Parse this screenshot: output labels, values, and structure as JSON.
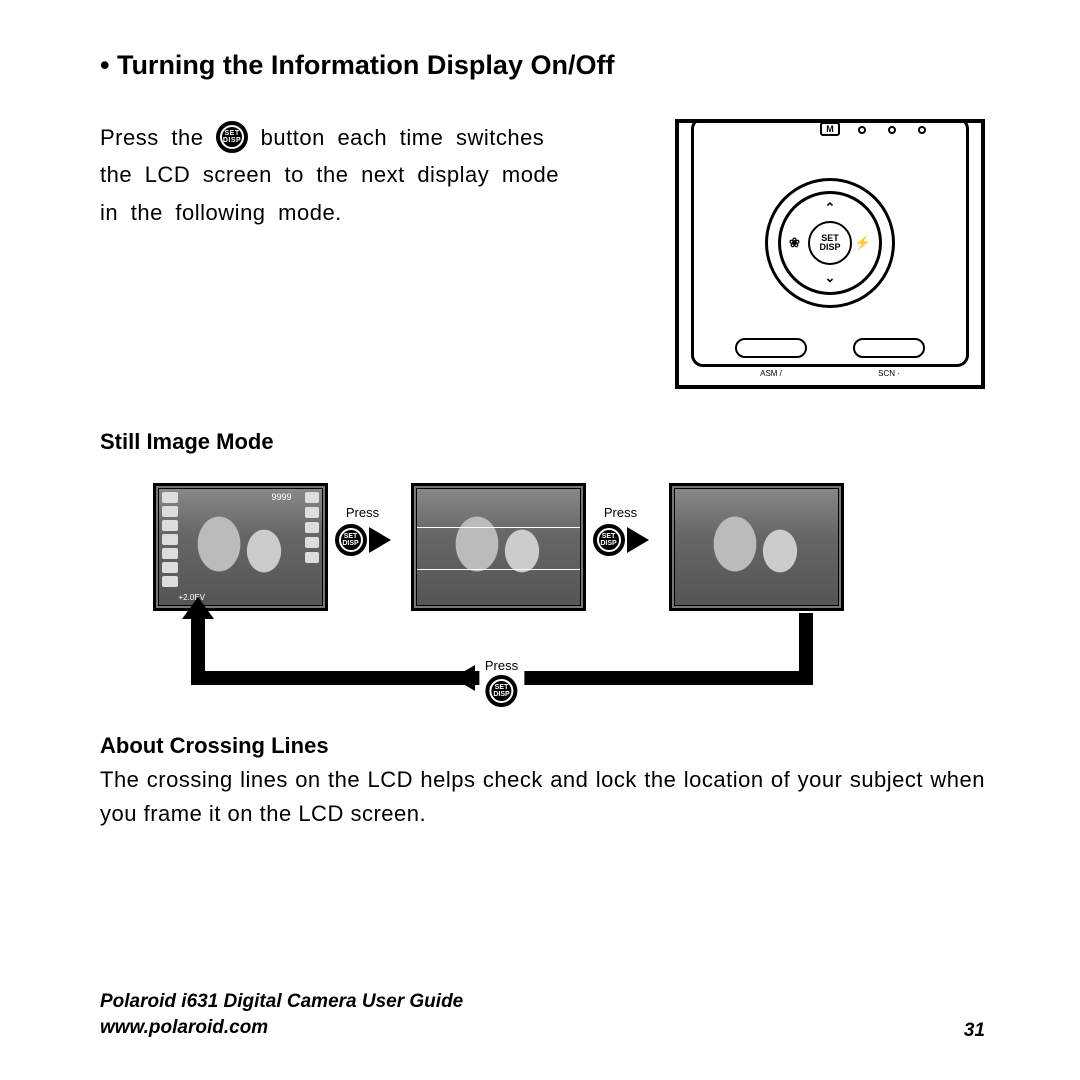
{
  "heading": "• Turning the Information Display On/Off",
  "intro_before": "Press the ",
  "intro_after": " button each time switches the LCD screen to the next display mode in the following mode.",
  "button": {
    "line1": "SET",
    "line2": "DISP"
  },
  "camera": {
    "mode_icon": "M",
    "center_line1": "SET",
    "center_line2": "DISP",
    "left_label": "ASM /",
    "right_label": "SCN ·"
  },
  "subhead": "Still Image Mode",
  "osd": {
    "shots": "9999",
    "ev": "+2.0EV"
  },
  "press_label": "Press",
  "about_head": "About Crossing Lines",
  "about_body": "The crossing lines on the LCD helps check and lock the location of your subject when you frame it on the LCD screen.",
  "footer": {
    "title": "Polaroid i631 Digital Camera User Guide",
    "url": "www.polaroid.com",
    "page": "31"
  }
}
